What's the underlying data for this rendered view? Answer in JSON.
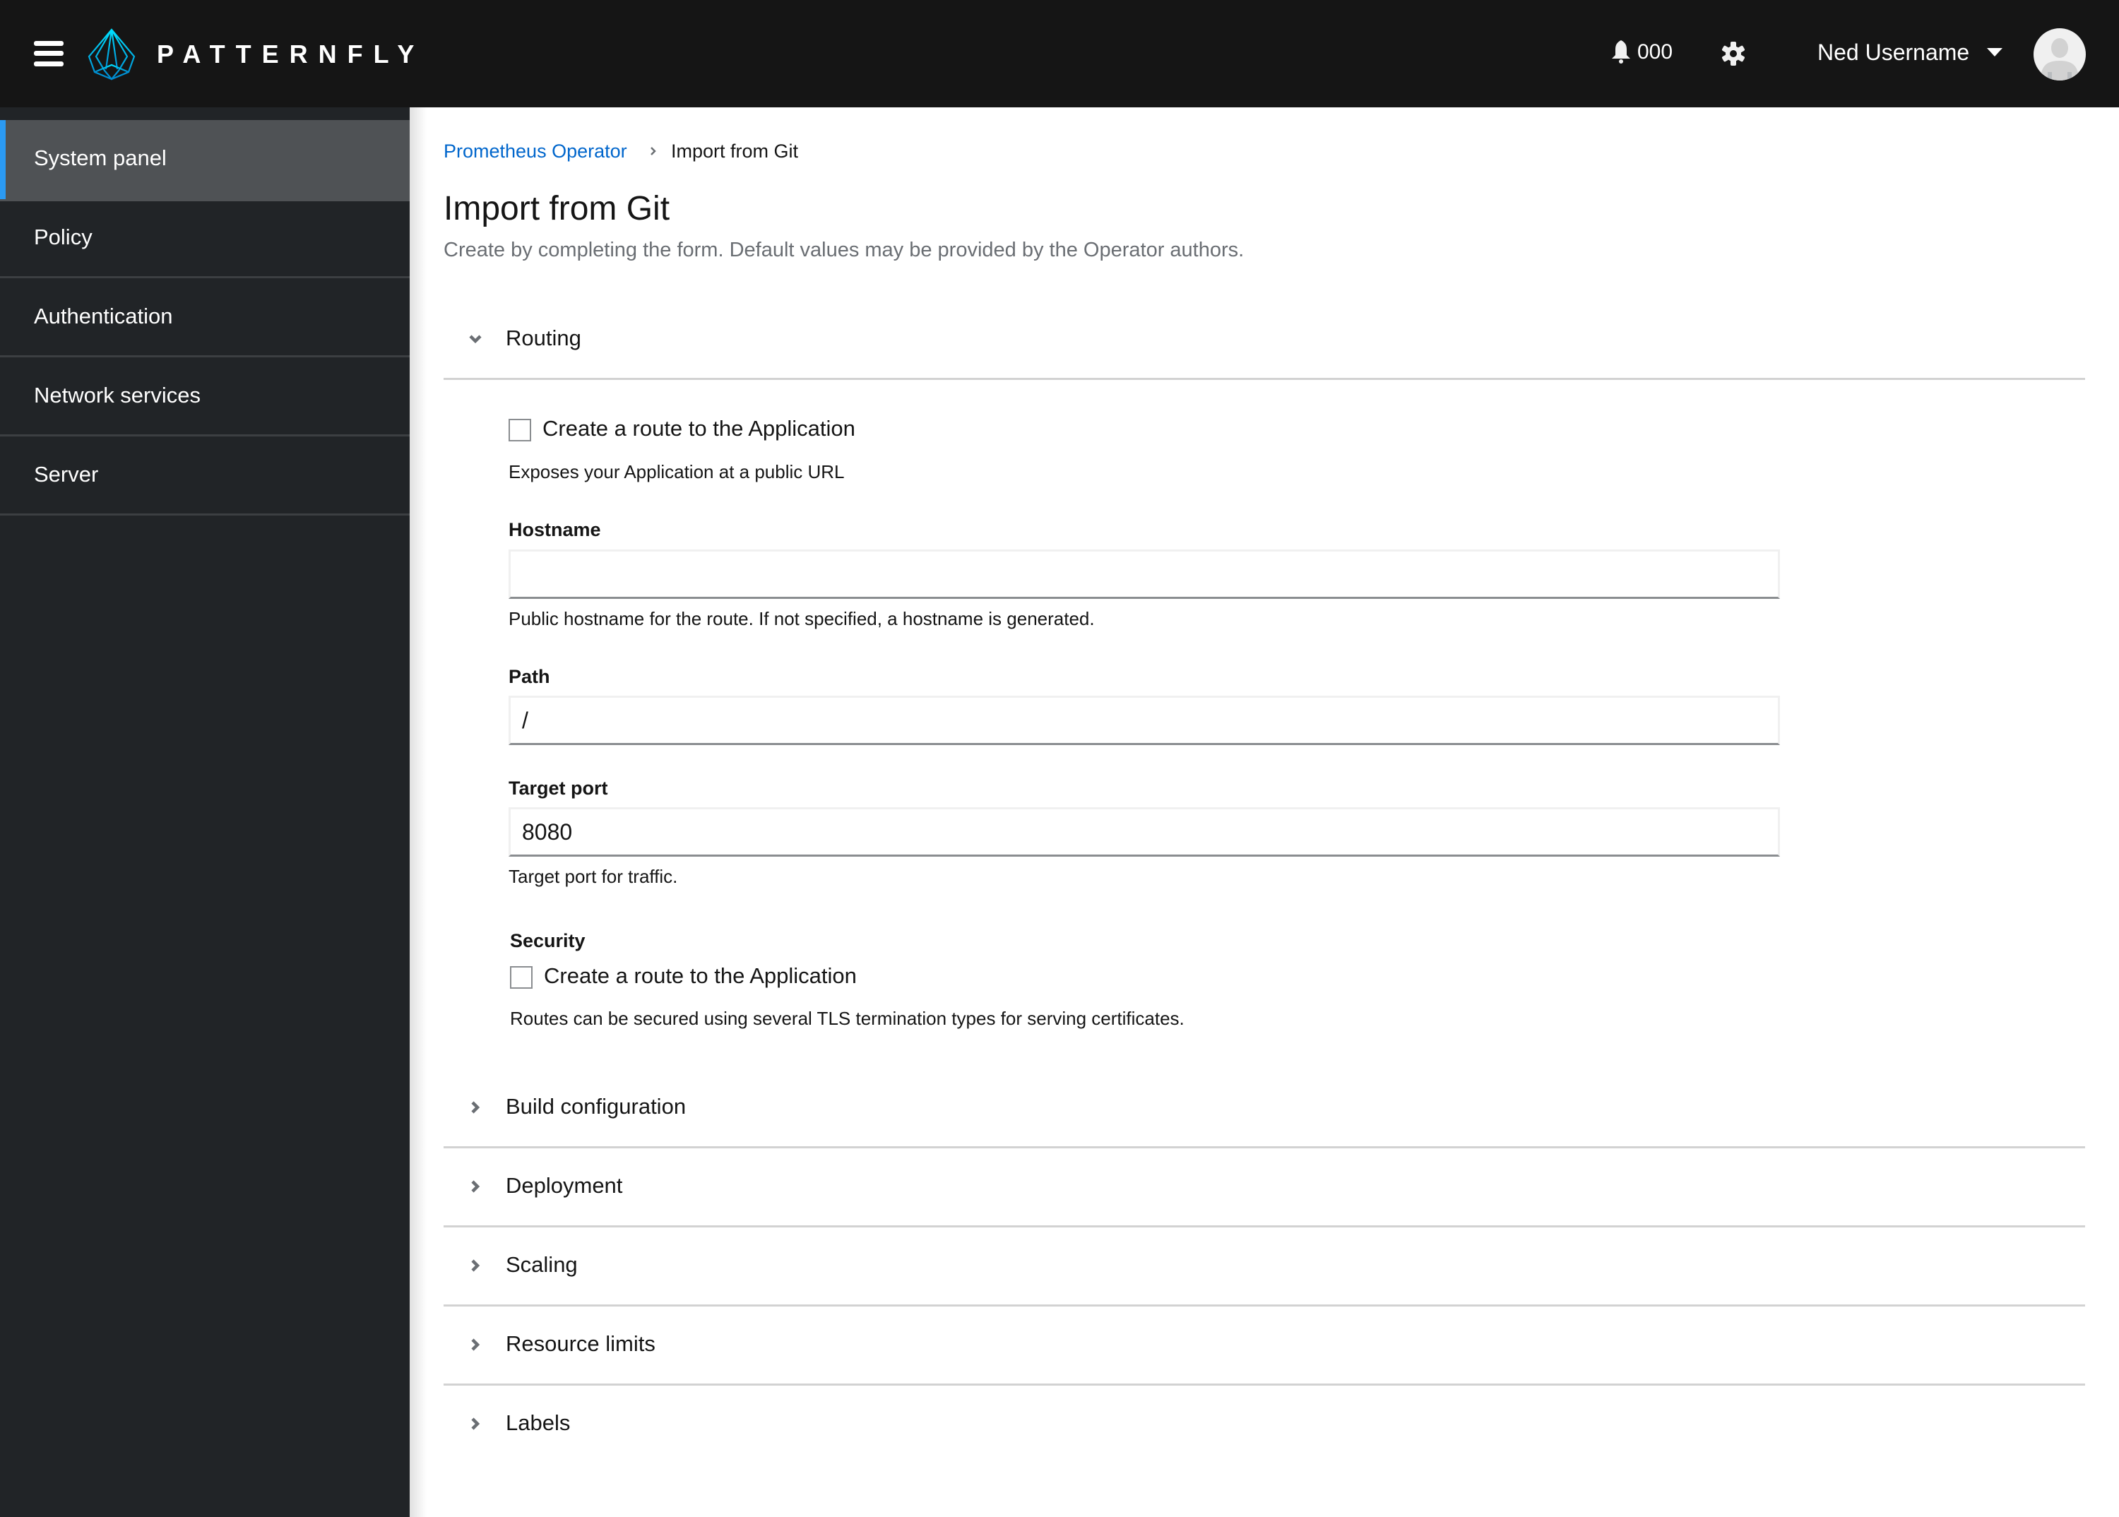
{
  "header": {
    "brand": "PATTERNFLY",
    "notifications_count": "000",
    "user_name": "Ned Username",
    "icons": {
      "menu": "hamburger-icon",
      "logo": "patternfly-logo-icon",
      "notifications": "bell-icon",
      "settings": "gear-icon",
      "user_menu": "caret-down-icon",
      "avatar": "user-avatar-icon"
    }
  },
  "sidebar": {
    "items": [
      {
        "label": "System panel",
        "active": true
      },
      {
        "label": "Policy",
        "active": false
      },
      {
        "label": "Authentication",
        "active": false
      },
      {
        "label": "Network services",
        "active": false
      },
      {
        "label": "Server",
        "active": false
      }
    ]
  },
  "breadcrumb": {
    "parent": "Prometheus Operator",
    "current": "Import from Git"
  },
  "page": {
    "title": "Import from Git",
    "subtitle": "Create by completing the form. Default values may be provided by the Operator authors."
  },
  "sections": {
    "routing": {
      "label": "Routing",
      "expanded": true,
      "route_checkbox": {
        "label": "Create a route to the Application",
        "checked": false
      },
      "route_helper": "Exposes your Application at a public URL",
      "hostname": {
        "label": "Hostname",
        "value": "",
        "helper": "Public hostname for the route. If not specified, a hostname is generated."
      },
      "path": {
        "label": "Path",
        "value": "/"
      },
      "target_port": {
        "label": "Target port",
        "value": "8080",
        "helper": "Target port for traffic."
      },
      "security": {
        "label": "Security",
        "checkbox": {
          "label": "Create a route to the Application",
          "checked": false
        },
        "helper": "Routes can be secured using several TLS termination types for serving certificates."
      }
    },
    "collapsed": [
      {
        "label": "Build configuration",
        "expanded": false
      },
      {
        "label": "Deployment",
        "expanded": false
      },
      {
        "label": "Scaling",
        "expanded": false
      },
      {
        "label": "Resource limits",
        "expanded": false
      },
      {
        "label": "Labels",
        "expanded": false
      }
    ]
  },
  "colors": {
    "masthead": "#151515",
    "sidebar": "#212427",
    "sidebar_active": "#4f5255",
    "accent": "#2b9af3",
    "link": "#0066cc",
    "separator": "#d2d2d2"
  }
}
